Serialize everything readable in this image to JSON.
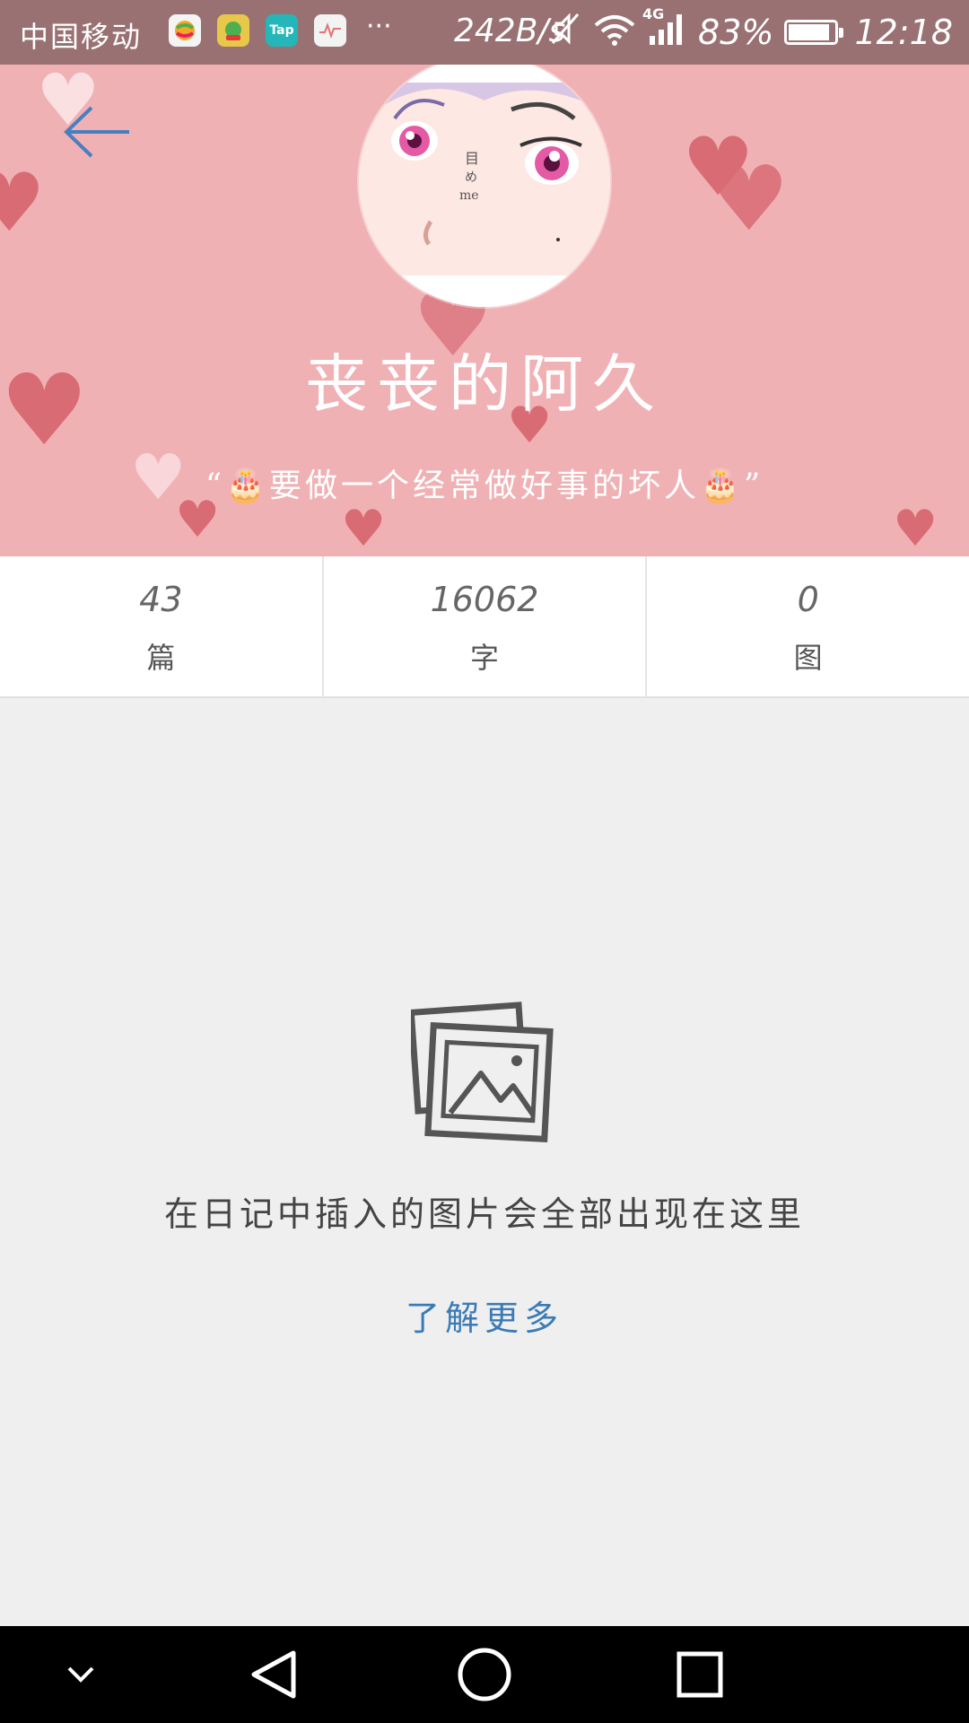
{
  "status_bar": {
    "carrier": "中国移动",
    "app_icons": [
      {
        "name": "ball-app-icon",
        "color": "#f2f2f2",
        "label": ""
      },
      {
        "name": "game-app-icon",
        "color": "#e8c84a",
        "label": ""
      },
      {
        "name": "taptap-app-icon",
        "color": "#24b6b9",
        "label": "Tap"
      },
      {
        "name": "health-app-icon",
        "color": "#f3f3f3",
        "label": ""
      }
    ],
    "more": "···",
    "net_speed": "242B/s",
    "network_type": "4G",
    "battery": "83%",
    "battery_level": 0.83,
    "time": "12:18"
  },
  "profile": {
    "name": "丧丧的阿久",
    "motto": "“🎂要做一个经常做好事的坏人🎂”",
    "accent_color": "#f0b1b5"
  },
  "stats": [
    {
      "value": "43",
      "unit": "篇"
    },
    {
      "value": "16062",
      "unit": "字"
    },
    {
      "value": "0",
      "unit": "图"
    }
  ],
  "empty_state": {
    "message": "在日记中插入的图片会全部出现在这里",
    "link": "了解更多",
    "link_color": "#3b7bb5"
  },
  "nav_bar": {
    "buttons": [
      "collapse",
      "back",
      "home",
      "recents"
    ]
  }
}
